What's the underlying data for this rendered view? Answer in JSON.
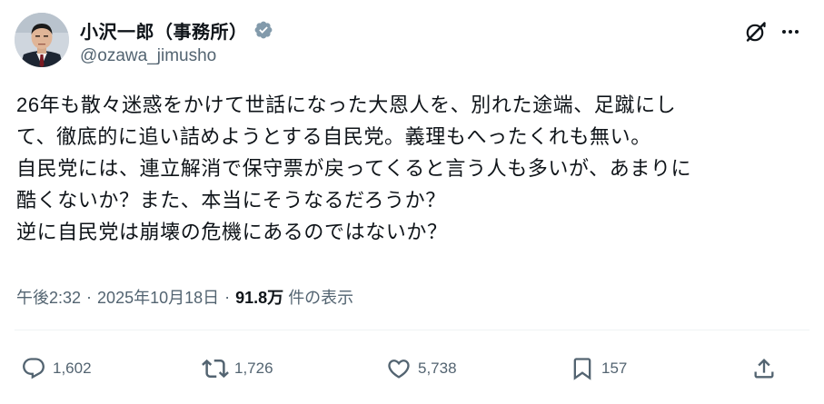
{
  "author": {
    "display_name": "小沢一郎（事務所）",
    "handle": "@ozawa_jimusho",
    "verified": true
  },
  "tweet": {
    "lines": [
      "26年も散々迷惑をかけて世話になった大恩人を、別れた途端、足蹴にし",
      "て、徹底的に追い詰めようとする自民党。義理もへったくれも無い。",
      "自民党には、連立解消で保守票が戻ってくると言う人も多いが、あまりに",
      "酷くないか？また、本当にそうなるだろうか？",
      "逆に自民党は崩壊の危機にあるのではないか？"
    ],
    "time": "午後2:32",
    "separator": "·",
    "date": "2025年10月18日",
    "views_count": "91.8万",
    "views_label": "件の表示"
  },
  "actions": {
    "replies": "1,602",
    "reposts": "1,726",
    "likes": "5,738",
    "bookmarks": "157"
  },
  "icons": {
    "verified": "verified-badge-icon",
    "grok": "grok-icon",
    "more": "more-icon",
    "reply": "reply-icon",
    "repost": "repost-icon",
    "like": "heart-icon",
    "bookmark": "bookmark-icon",
    "share": "share-icon"
  },
  "colors": {
    "text": "#0f1419",
    "secondary": "#536471",
    "verified_badge": "#829aab",
    "divider": "#eff3f4"
  }
}
